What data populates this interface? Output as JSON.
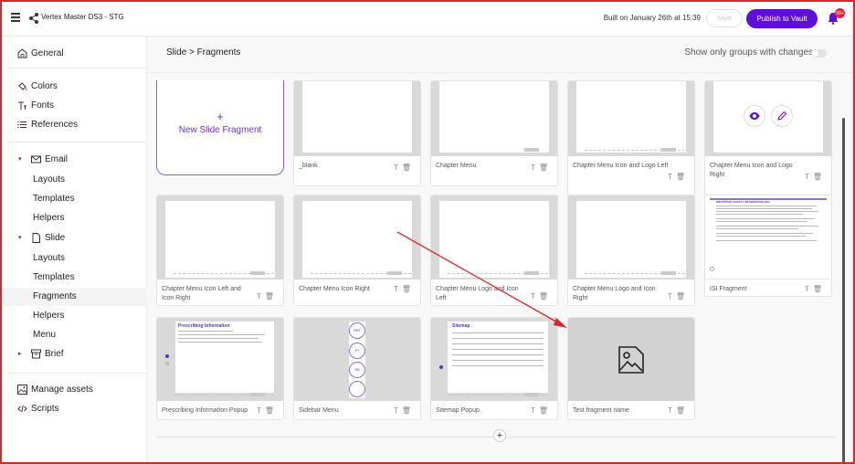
{
  "header": {
    "app_title": "Vertex Master DS3 - STG",
    "built_on": "Built on January 26th at 15:39",
    "save_label": "Save",
    "publish_label": "Publish to Vault",
    "notification_count": "99+"
  },
  "sidebar": {
    "general": "General",
    "colors": "Colors",
    "fonts": "Fonts",
    "references": "References",
    "email": "Email",
    "email_layouts": "Layouts",
    "email_templates": "Templates",
    "email_helpers": "Helpers",
    "slide": "Slide",
    "slide_layouts": "Layouts",
    "slide_templates": "Templates",
    "slide_fragments": "Fragments",
    "slide_helpers": "Helpers",
    "slide_menu": "Menu",
    "brief": "Brief",
    "manage_assets": "Manage assets",
    "scripts": "Scripts"
  },
  "main": {
    "breadcrumb": "Slide > Fragments",
    "toggle_label": "Show only groups with changes",
    "new_fragment_plus": "+",
    "new_fragment_label": "New Slide Fragment",
    "add_row": "+",
    "fragments": [
      "_blank",
      "Chapter Menu",
      "Chapter Menu Icon and Logo Left",
      "Chapter Menu Icon and Logo Right",
      "Chapter Menu Icon Left and Icon Right",
      "Chapter Menu Icon Right",
      "Chapter Menu Logo and Icon Left",
      "Chapter Menu Logo and Icon Right",
      "ISI Fragment",
      "Prescribing Information Popup",
      "Sidebar Menu",
      "Sitemap Popup",
      "Test fragment name"
    ],
    "thumb_prescribing_title": "Prescribing Information",
    "thumb_sitemap_title": "Sitemap",
    "thumb_isi_title": "IMPORTANT SAFETY INFORMATION (ISI)",
    "thumb_sidebar_btns": [
      "REF",
      "PI",
      "SD"
    ]
  },
  "colors": {
    "accent": "#5f0fd9",
    "badge": "#e8233a",
    "annotation": "#e0251e"
  }
}
